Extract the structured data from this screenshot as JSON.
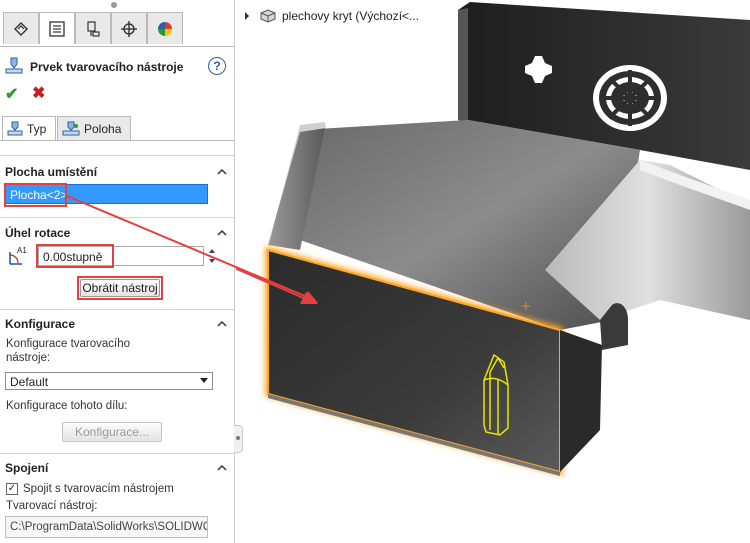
{
  "feature_manager": {
    "tabs": [
      {
        "icon": "feature-tree-icon",
        "active": false
      },
      {
        "icon": "property-manager-icon",
        "active": true
      },
      {
        "icon": "configuration-manager-icon",
        "active": false
      },
      {
        "icon": "dimxpert-icon",
        "active": false
      },
      {
        "icon": "appearance-icon",
        "active": false
      }
    ]
  },
  "property_manager": {
    "title": "Prvek tvarovacího nástroje",
    "help_label": "?",
    "ok_label": "✔",
    "cancel_label": "✖",
    "subtabs": [
      {
        "label": "Typ",
        "active": true
      },
      {
        "label": "Poloha",
        "active": false
      }
    ]
  },
  "placement": {
    "title": "Plocha umístění",
    "face_value": "Plocha<2>"
  },
  "rotation": {
    "title": "Úhel rotace",
    "icon_label": "A1",
    "angle_value": "0.00stupně",
    "flip_button": "Obrátit nástroj"
  },
  "configuration": {
    "title": "Konfigurace",
    "tool_config_label": "Konfigurace tvarovacího nástroje:",
    "tool_config_value": "Default",
    "part_config_label": "Konfigurace tohoto dílu:",
    "part_config_button": "Konfigurace..."
  },
  "link": {
    "title": "Spojení",
    "checkbox_label": "Spojit s tvarovacím nástrojem",
    "checkbox_mark": "✓",
    "tool_label": "Tvarovací nástroj:",
    "tool_path": "C:\\ProgramData\\SolidWorks\\SOLIDWO"
  },
  "viewport": {
    "tree_item": "plechovy kryt  (Výchozí<..."
  },
  "colors": {
    "selection_blue": "#3399ff",
    "callout_red": "#e3403f",
    "highlight_orange": "#ffa620",
    "tool_yellow": "#e6e600"
  }
}
